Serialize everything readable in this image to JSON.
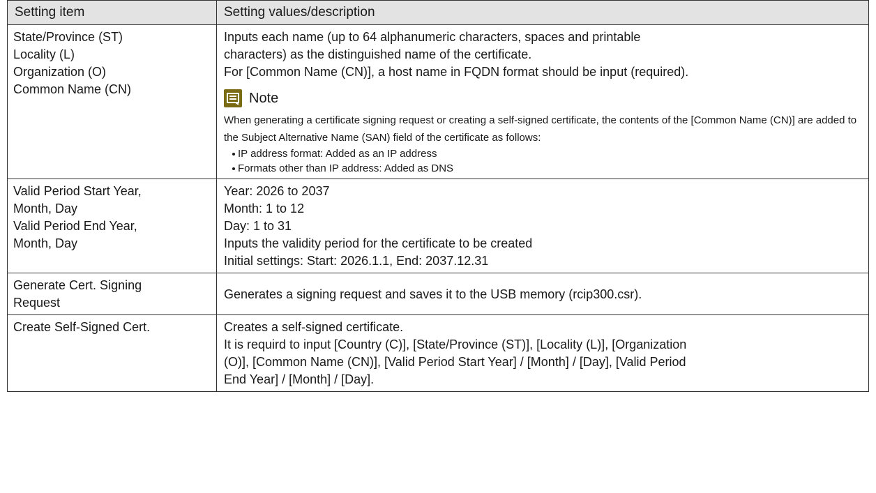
{
  "table": {
    "headers": [
      "Setting item",
      "Setting values/description"
    ],
    "rows": [
      {
        "item_lines": [
          "State/Province (ST)",
          "Locality (L)",
          "Organization (O)",
          "Common Name (CN)"
        ],
        "desc_lines": [
          "Inputs each name (up to 64 alphanumeric characters, spaces and printable",
          "characters) as the distinguished name of the certificate.",
          "For [Common Name (CN)], a host name in FQDN format should be input (required)."
        ],
        "note": {
          "icon": "note-icon",
          "title": "Note",
          "text": "When generating a certificate signing request or creating a self-signed certificate, the contents of the [Common Name (CN)] are added to the Subject Alternative Name (SAN) field of the certificate as follows:",
          "bullets": [
            "IP address format: Added as an IP address",
            "Formats other than IP address: Added as DNS"
          ]
        }
      },
      {
        "item_lines": [
          "Valid Period Start Year,",
          "Month, Day",
          "Valid Period End Year,",
          "Month, Day"
        ],
        "desc_lines": [
          "Year: 2026 to 2037",
          "Month: 1 to 12",
          "Day: 1 to 31",
          "Inputs the validity period for the certificate to be created",
          "Initial settings: Start: 2026.1.1, End: 2037.12.31"
        ]
      },
      {
        "item_lines": [
          "Generate Cert. Signing",
          "Request"
        ],
        "desc_lines": [
          "Generates a signing request and saves it to the USB memory (rcip300.csr)."
        ]
      },
      {
        "item_lines": [
          "Create Self-Signed Cert."
        ],
        "desc_lines": [
          "Creates a self-signed certificate.",
          "It is requird to input [Country (C)], [State/Province (ST)], [Locality (L)], [Organization",
          "(O)], [Common Name (CN)], [Valid Period Start Year] / [Month] / [Day], [Valid Period",
          "End Year] / [Month] / [Day]."
        ]
      }
    ]
  }
}
